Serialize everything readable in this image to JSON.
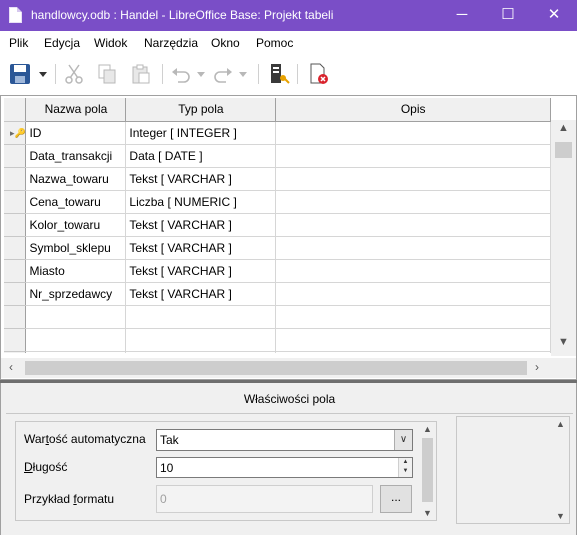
{
  "window": {
    "title": "handlowcy.odb : Handel - LibreOffice Base: Projekt tabeli",
    "minimize_glyph": "─",
    "maximize_glyph": "☐",
    "close_glyph": "✕"
  },
  "menu": {
    "items": [
      {
        "label": "Plik"
      },
      {
        "label": "Edycja"
      },
      {
        "label": "Widok"
      },
      {
        "label": "Narzędzia"
      },
      {
        "label": "Okno"
      },
      {
        "label": "Pomoc"
      }
    ]
  },
  "toolbar": {
    "icons": [
      "save-icon",
      "cut-icon",
      "copy-icon",
      "paste-icon",
      "undo-icon",
      "redo-icon",
      "primary-key-icon",
      "index-design-icon"
    ]
  },
  "table": {
    "columns": [
      "Nazwa pola",
      "Typ pola",
      "Opis"
    ],
    "rows": [
      {
        "name": "ID",
        "type": "Integer [ INTEGER ]",
        "description": "",
        "primary_key": true
      },
      {
        "name": "Data_transakcji",
        "type": "Data [ DATE ]",
        "description": ""
      },
      {
        "name": "Nazwa_towaru",
        "type": "Tekst [ VARCHAR ]",
        "description": ""
      },
      {
        "name": "Cena_towaru",
        "type": "Liczba [ NUMERIC ]",
        "description": ""
      },
      {
        "name": "Kolor_towaru",
        "type": "Tekst [ VARCHAR ]",
        "description": ""
      },
      {
        "name": "Symbol_sklepu",
        "type": "Tekst [ VARCHAR ]",
        "description": ""
      },
      {
        "name": "Miasto",
        "type": "Tekst [ VARCHAR ]",
        "description": ""
      },
      {
        "name": "Nr_sprzedawcy",
        "type": "Tekst [ VARCHAR ]",
        "description": ""
      }
    ],
    "key_marker": "▸🔑",
    "empty_rows": 3
  },
  "properties": {
    "title": "Właściwości pola",
    "autovalue": {
      "label_before": "War",
      "label_underlined": "t",
      "label_after": "ość automatyczna",
      "value": "Tak"
    },
    "length": {
      "label_underlined": "D",
      "label_after": "ługość",
      "value": "10"
    },
    "format_example": {
      "label_before": "Przykład ",
      "label_underlined": "f",
      "label_after": "ormatu",
      "value": "0",
      "button_label": "..."
    }
  },
  "colors": {
    "titlebar": "#7a4ec7",
    "save_icon": "#2b5797",
    "delete_icon": "#d9232d"
  }
}
